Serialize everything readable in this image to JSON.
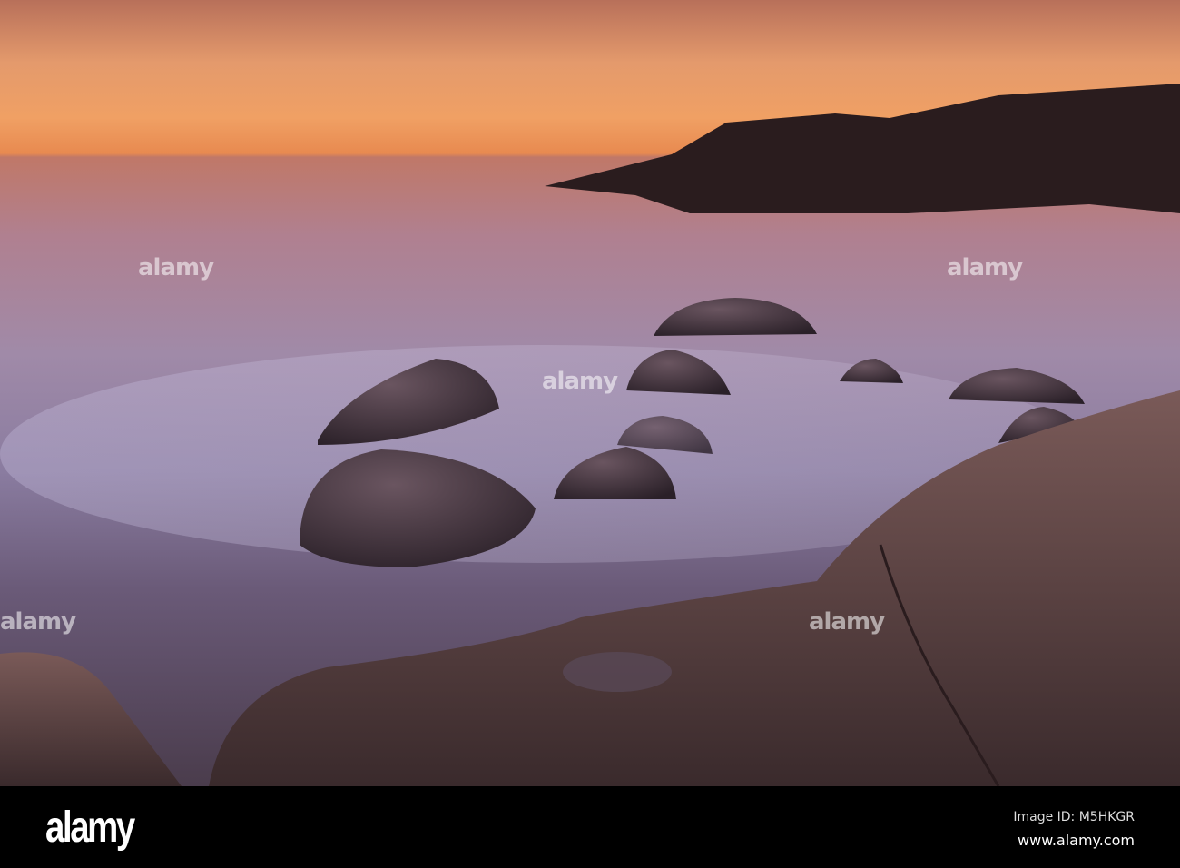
{
  "watermark": {
    "text": "alamy"
  },
  "footer": {
    "logo": "alamy",
    "image_id": "Image ID: M5HKGR",
    "website": "www.alamy.com"
  },
  "colors": {
    "sky_top": "#b8705a",
    "horizon": "#f0a064",
    "water": "#a08aa8",
    "rock": "#4a3c4c"
  }
}
